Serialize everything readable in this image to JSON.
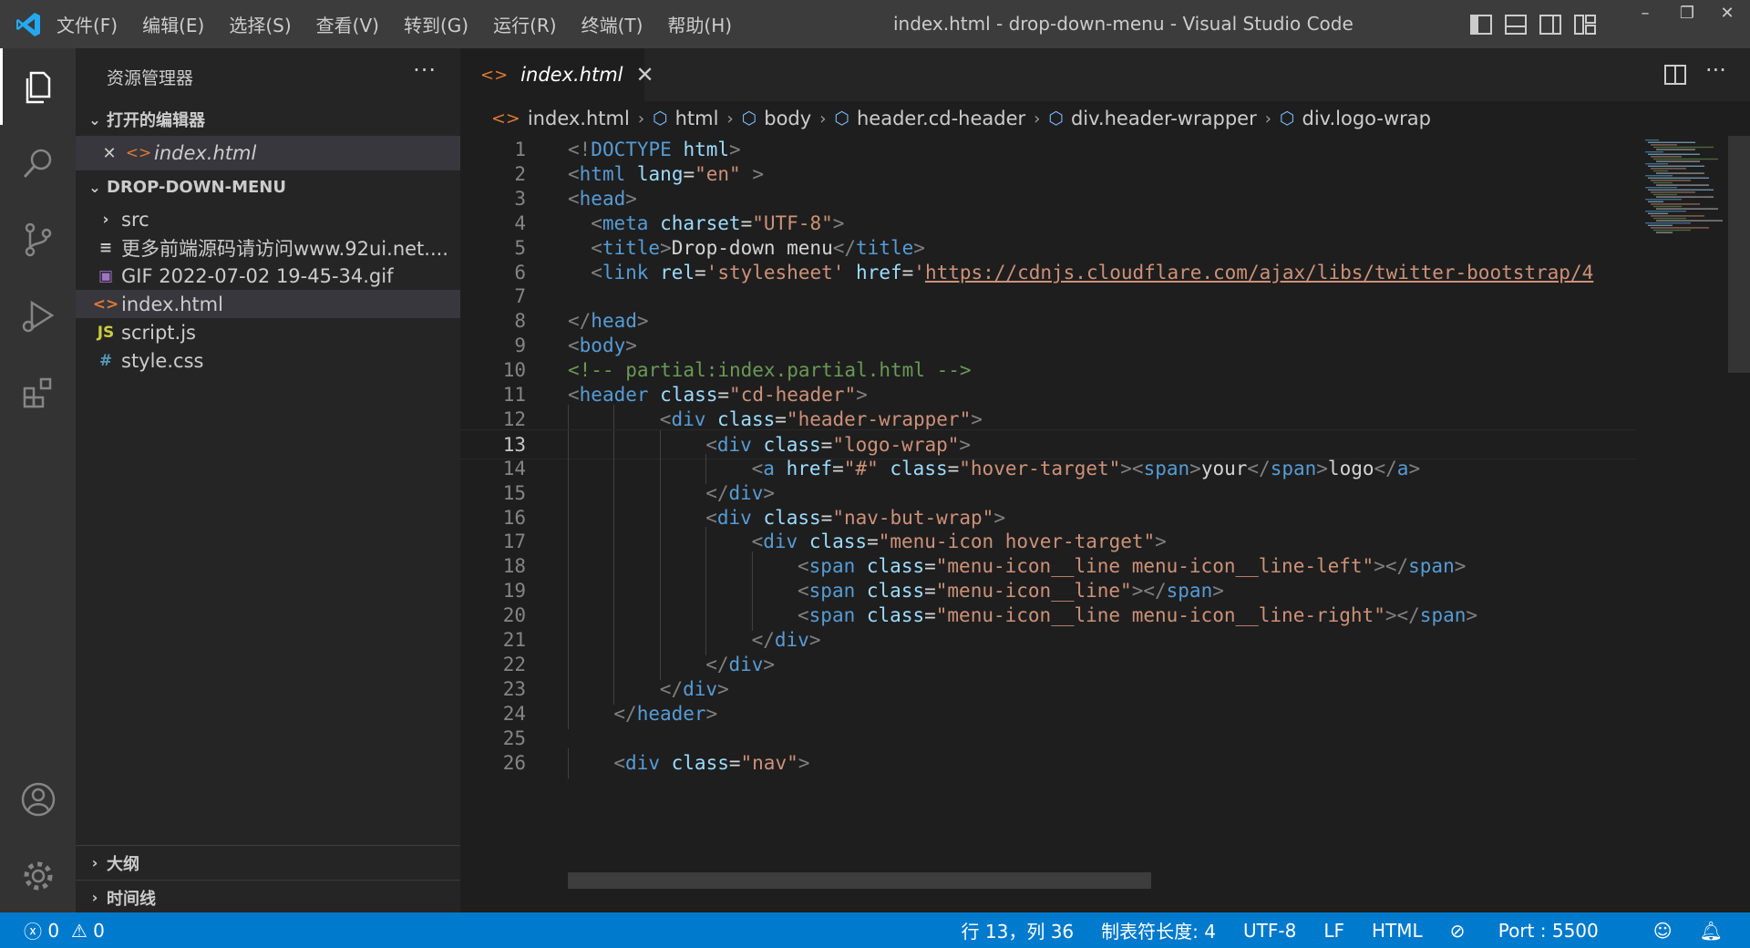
{
  "window": {
    "title": "index.html - drop-down-menu - Visual Studio Code"
  },
  "menu": [
    "文件(F)",
    "编辑(E)",
    "选择(S)",
    "查看(V)",
    "转到(G)",
    "运行(R)",
    "终端(T)",
    "帮助(H)"
  ],
  "window_controls": {
    "minimize": "–",
    "restore": "❐",
    "close": "✕"
  },
  "sidebar": {
    "title": "资源管理器",
    "more": "···",
    "open_editors": {
      "label": "打开的编辑器",
      "items": [
        {
          "name": "index.html",
          "icon": "html-file-icon",
          "close": "✕"
        }
      ]
    },
    "project": {
      "label": "DROP-DOWN-MENU",
      "items": [
        {
          "name": "src",
          "icon": "folder-chevron-icon",
          "glyph": "›"
        },
        {
          "name": "更多前端源码请访问www.92ui.net....",
          "icon": "text-file-icon",
          "glyph": "≡"
        },
        {
          "name": "GIF 2022-07-02 19-45-34.gif",
          "icon": "image-file-icon",
          "glyph": "▣"
        },
        {
          "name": "index.html",
          "icon": "html-file-icon",
          "glyph": "<>"
        },
        {
          "name": "script.js",
          "icon": "js-file-icon",
          "glyph": "JS"
        },
        {
          "name": "style.css",
          "icon": "css-file-icon",
          "glyph": "#"
        }
      ]
    },
    "outline": "大纲",
    "timeline": "时间线"
  },
  "tab": {
    "label": "index.html",
    "close": "✕",
    "more": "···"
  },
  "breadcrumbs": [
    "index.html",
    "html",
    "body",
    "header.cd-header",
    "div.header-wrapper",
    "div.logo-wrap"
  ],
  "code": {
    "current_line": 13,
    "lines": [
      {
        "n": "1",
        "indent": 0,
        "t": [
          [
            "t",
            "<!"
          ],
          [
            "tg",
            "DOCTYPE"
          ],
          [
            "tx2",
            " "
          ],
          [
            "at",
            "html"
          ],
          [
            "t",
            ">"
          ]
        ]
      },
      {
        "n": "2",
        "indent": 0,
        "t": [
          [
            "t",
            "<"
          ],
          [
            "tg",
            "html"
          ],
          [
            "tx2",
            " "
          ],
          [
            "at",
            "lang"
          ],
          [
            "tx2",
            "="
          ],
          [
            "st",
            "\"en\""
          ],
          [
            "tx2",
            " "
          ],
          [
            "t",
            ">"
          ]
        ]
      },
      {
        "n": "3",
        "indent": 0,
        "t": [
          [
            "t",
            "<"
          ],
          [
            "tg",
            "head"
          ],
          [
            "t",
            ">"
          ]
        ]
      },
      {
        "n": "4",
        "indent": 1,
        "t": [
          [
            "t",
            "<"
          ],
          [
            "tg",
            "meta"
          ],
          [
            "tx2",
            " "
          ],
          [
            "at",
            "charset"
          ],
          [
            "tx2",
            "="
          ],
          [
            "st",
            "\"UTF-8\""
          ],
          [
            "t",
            ">"
          ]
        ]
      },
      {
        "n": "5",
        "indent": 1,
        "t": [
          [
            "t",
            "<"
          ],
          [
            "tg",
            "title"
          ],
          [
            "t",
            ">"
          ],
          [
            "tx2",
            "Drop-down menu"
          ],
          [
            "t",
            "</"
          ],
          [
            "tg",
            "title"
          ],
          [
            "t",
            ">"
          ]
        ]
      },
      {
        "n": "6",
        "indent": 1,
        "t": [
          [
            "t",
            "<"
          ],
          [
            "tg",
            "link"
          ],
          [
            "tx2",
            " "
          ],
          [
            "at",
            "rel"
          ],
          [
            "tx2",
            "="
          ],
          [
            "st",
            "'stylesheet'"
          ],
          [
            "tx2",
            " "
          ],
          [
            "at",
            "href"
          ],
          [
            "tx2",
            "="
          ],
          [
            "st",
            "'"
          ],
          [
            "st url",
            "https://cdnjs.cloudflare.com/ajax/libs/twitter-bootstrap/4"
          ]
        ]
      },
      {
        "n": "7",
        "indent": 0,
        "t": []
      },
      {
        "n": "8",
        "indent": 0,
        "t": [
          [
            "t",
            "</"
          ],
          [
            "tg",
            "head"
          ],
          [
            "t",
            ">"
          ]
        ]
      },
      {
        "n": "9",
        "indent": 0,
        "t": [
          [
            "t",
            "<"
          ],
          [
            "tg",
            "body"
          ],
          [
            "t",
            ">"
          ]
        ]
      },
      {
        "n": "10",
        "indent": 0,
        "t": [
          [
            "cm",
            "<!-- partial:index.partial.html -->"
          ]
        ]
      },
      {
        "n": "11",
        "indent": 0,
        "t": [
          [
            "t",
            "<"
          ],
          [
            "tg",
            "header"
          ],
          [
            "tx2",
            " "
          ],
          [
            "at",
            "class"
          ],
          [
            "tx2",
            "="
          ],
          [
            "st",
            "\"cd-header\""
          ],
          [
            "t",
            ">"
          ]
        ]
      },
      {
        "n": "12",
        "indent": 4,
        "t": [
          [
            "t",
            "<"
          ],
          [
            "tg",
            "div"
          ],
          [
            "tx2",
            " "
          ],
          [
            "at",
            "class"
          ],
          [
            "tx2",
            "="
          ],
          [
            "st",
            "\"header-wrapper\""
          ],
          [
            "t",
            ">"
          ]
        ]
      },
      {
        "n": "13",
        "indent": 6,
        "t": [
          [
            "t",
            "<"
          ],
          [
            "tg",
            "div"
          ],
          [
            "tx2",
            " "
          ],
          [
            "at",
            "class"
          ],
          [
            "tx2",
            "="
          ],
          [
            "st",
            "\"logo-wrap\""
          ],
          [
            "t",
            ">"
          ]
        ]
      },
      {
        "n": "14",
        "indent": 8,
        "t": [
          [
            "t",
            "<"
          ],
          [
            "tg",
            "a"
          ],
          [
            "tx2",
            " "
          ],
          [
            "at",
            "href"
          ],
          [
            "tx2",
            "="
          ],
          [
            "st",
            "\"#\""
          ],
          [
            "tx2",
            " "
          ],
          [
            "at",
            "class"
          ],
          [
            "tx2",
            "="
          ],
          [
            "st",
            "\"hover-target\""
          ],
          [
            "t",
            "><"
          ],
          [
            "tg",
            "span"
          ],
          [
            "t",
            ">"
          ],
          [
            "tx2",
            "your"
          ],
          [
            "t",
            "</"
          ],
          [
            "tg",
            "span"
          ],
          [
            "t",
            ">"
          ],
          [
            "tx2",
            "logo"
          ],
          [
            "t",
            "</"
          ],
          [
            "tg",
            "a"
          ],
          [
            "t",
            ">"
          ]
        ]
      },
      {
        "n": "15",
        "indent": 6,
        "t": [
          [
            "t",
            "</"
          ],
          [
            "tg",
            "div"
          ],
          [
            "t",
            ">"
          ]
        ]
      },
      {
        "n": "16",
        "indent": 6,
        "t": [
          [
            "t",
            "<"
          ],
          [
            "tg",
            "div"
          ],
          [
            "tx2",
            " "
          ],
          [
            "at",
            "class"
          ],
          [
            "tx2",
            "="
          ],
          [
            "st",
            "\"nav-but-wrap\""
          ],
          [
            "t",
            ">"
          ]
        ]
      },
      {
        "n": "17",
        "indent": 8,
        "t": [
          [
            "t",
            "<"
          ],
          [
            "tg",
            "div"
          ],
          [
            "tx2",
            " "
          ],
          [
            "at",
            "class"
          ],
          [
            "tx2",
            "="
          ],
          [
            "st",
            "\"menu-icon hover-target\""
          ],
          [
            "t",
            ">"
          ]
        ]
      },
      {
        "n": "18",
        "indent": 10,
        "t": [
          [
            "t",
            "<"
          ],
          [
            "tg",
            "span"
          ],
          [
            "tx2",
            " "
          ],
          [
            "at",
            "class"
          ],
          [
            "tx2",
            "="
          ],
          [
            "st",
            "\"menu-icon__line menu-icon__line-left\""
          ],
          [
            "t",
            "></"
          ],
          [
            "tg",
            "span"
          ],
          [
            "t",
            ">"
          ]
        ]
      },
      {
        "n": "19",
        "indent": 10,
        "t": [
          [
            "t",
            "<"
          ],
          [
            "tg",
            "span"
          ],
          [
            "tx2",
            " "
          ],
          [
            "at",
            "class"
          ],
          [
            "tx2",
            "="
          ],
          [
            "st",
            "\"menu-icon__line\""
          ],
          [
            "t",
            "></"
          ],
          [
            "tg",
            "span"
          ],
          [
            "t",
            ">"
          ]
        ]
      },
      {
        "n": "20",
        "indent": 10,
        "t": [
          [
            "t",
            "<"
          ],
          [
            "tg",
            "span"
          ],
          [
            "tx2",
            " "
          ],
          [
            "at",
            "class"
          ],
          [
            "tx2",
            "="
          ],
          [
            "st",
            "\"menu-icon__line menu-icon__line-right\""
          ],
          [
            "t",
            "></"
          ],
          [
            "tg",
            "span"
          ],
          [
            "t",
            ">"
          ]
        ]
      },
      {
        "n": "21",
        "indent": 8,
        "t": [
          [
            "t",
            "</"
          ],
          [
            "tg",
            "div"
          ],
          [
            "t",
            ">"
          ]
        ]
      },
      {
        "n": "22",
        "indent": 6,
        "t": [
          [
            "t",
            "</"
          ],
          [
            "tg",
            "div"
          ],
          [
            "t",
            ">"
          ]
        ]
      },
      {
        "n": "23",
        "indent": 4,
        "t": [
          [
            "t",
            "</"
          ],
          [
            "tg",
            "div"
          ],
          [
            "t",
            ">"
          ]
        ]
      },
      {
        "n": "24",
        "indent": 2,
        "t": [
          [
            "t",
            "</"
          ],
          [
            "tg",
            "header"
          ],
          [
            "t",
            ">"
          ]
        ]
      },
      {
        "n": "25",
        "indent": 0,
        "t": []
      },
      {
        "n": "26",
        "indent": 2,
        "t": [
          [
            "t",
            "<"
          ],
          [
            "tg",
            "div"
          ],
          [
            "tx2",
            " "
          ],
          [
            "at",
            "class"
          ],
          [
            "tx2",
            "="
          ],
          [
            "st",
            "\"nav\""
          ],
          [
            "t",
            ">"
          ]
        ]
      }
    ]
  },
  "status": {
    "errors": "0",
    "warnings": "0",
    "position": "行 13，列 36",
    "tab_size": "制表符长度: 4",
    "encoding": "UTF-8",
    "eol": "LF",
    "language": "HTML",
    "port": "Port : 5500"
  },
  "colors": {
    "accent": "#007acc",
    "titlebar": "#3c3c3c",
    "sidebar": "#252526",
    "editor": "#1e1e1e"
  }
}
